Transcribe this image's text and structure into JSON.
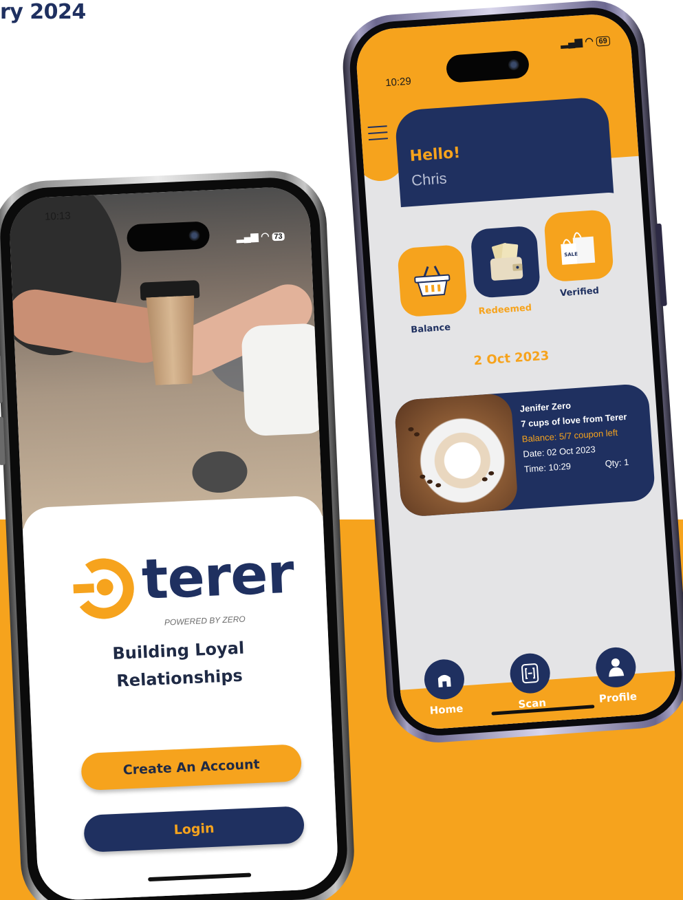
{
  "page": {
    "heading": "ry 2024"
  },
  "login_phone": {
    "status": {
      "time": "10:13",
      "battery": "73"
    },
    "logo": {
      "word": "terer",
      "powered_by": "POWERED BY ZERO"
    },
    "tagline_line1": "Building Loyal",
    "tagline_line2": "Relationships",
    "create_account_label": "Create An Account",
    "login_label": "Login"
  },
  "home_phone": {
    "status": {
      "time": "10:29",
      "battery": "69"
    },
    "greeting": "Hello!",
    "user_name": "Chris",
    "tiles": [
      {
        "label": "Balance",
        "icon": "basket-icon",
        "color": "#f6a31d"
      },
      {
        "label": "Redeemed",
        "icon": "wallet-icon",
        "color": "#1f3060"
      },
      {
        "label": "Verified",
        "icon": "shopping-bag-icon",
        "color": "#f6a31d"
      }
    ],
    "date_heading": "2 Oct 2023",
    "transaction": {
      "name": "Jenifer Zero",
      "description": "7 cups of love from Terer",
      "balance": "Balance: 5/7 coupon left",
      "date": "Date: 02 Oct 2023",
      "time": "Time: 10:29",
      "qty": "Qty: 1"
    },
    "nav": [
      {
        "label": "Home",
        "icon": "home-icon"
      },
      {
        "label": "Scan",
        "icon": "scan-icon"
      },
      {
        "label": "Profile",
        "icon": "profile-icon"
      }
    ]
  },
  "colors": {
    "brand_orange": "#f6a31d",
    "brand_navy": "#1f3060",
    "panel_grey": "#e4e4e6"
  }
}
